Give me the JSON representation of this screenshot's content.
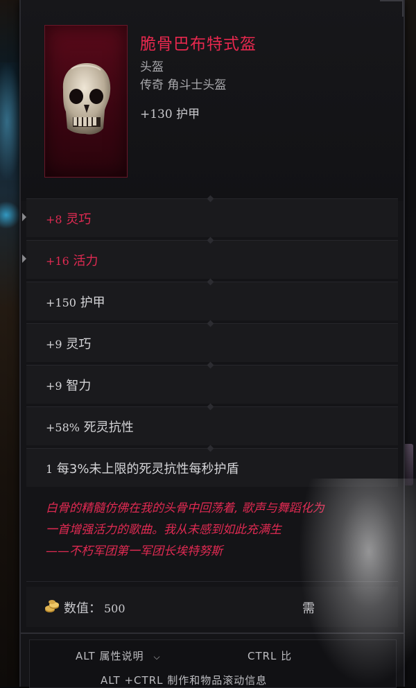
{
  "item": {
    "name": "脆骨巴布特式盔",
    "type": "头盔",
    "rarity": "传奇 角斗士头盔",
    "base_armor": "+130 护甲"
  },
  "stats": [
    {
      "value": "+8",
      "label": "灵巧",
      "color": "#e02a52"
    },
    {
      "value": "+16",
      "label": "活力",
      "color": "#e02a52"
    },
    {
      "value": "+150",
      "label": "护甲",
      "color": "#d5d5d8"
    },
    {
      "value": "+9",
      "label": "灵巧",
      "color": "#d5d5d8"
    },
    {
      "value": "+9",
      "label": "智力",
      "color": "#d5d5d8"
    },
    {
      "value": "+58%",
      "label": "死灵抗性",
      "color": "#d5d5d8"
    },
    {
      "value": "1",
      "label": "每3%未上限的死灵抗性每秒护盾",
      "color": "#d5d5d8"
    }
  ],
  "lore": {
    "line1": "白骨的精髓仿佛在我的头骨中回荡着, 歌声与舞蹈化为",
    "line2": "一首增强活力的歌曲。我从未感到如此充满生",
    "line3": "——不朽军团第一军团长埃特努斯"
  },
  "value": {
    "label": "数值：",
    "amount": "500",
    "require_label": "需"
  },
  "footer": {
    "hint_alt": "ALT 属性说明",
    "hint_ctrl": "CTRL 比",
    "hint_altctrl": "ALT +CTRL 制作和物品滚动信息"
  },
  "icons": {
    "item": "skull-helmet-icon",
    "coin": "gold-coins-icon",
    "chevron": "chevron-down-icon"
  },
  "colors": {
    "legendary_red": "#e8284e",
    "panel_bg": "#141417",
    "row_bg": "#1a1a1d",
    "icon_frame": "#5a0a1a"
  }
}
